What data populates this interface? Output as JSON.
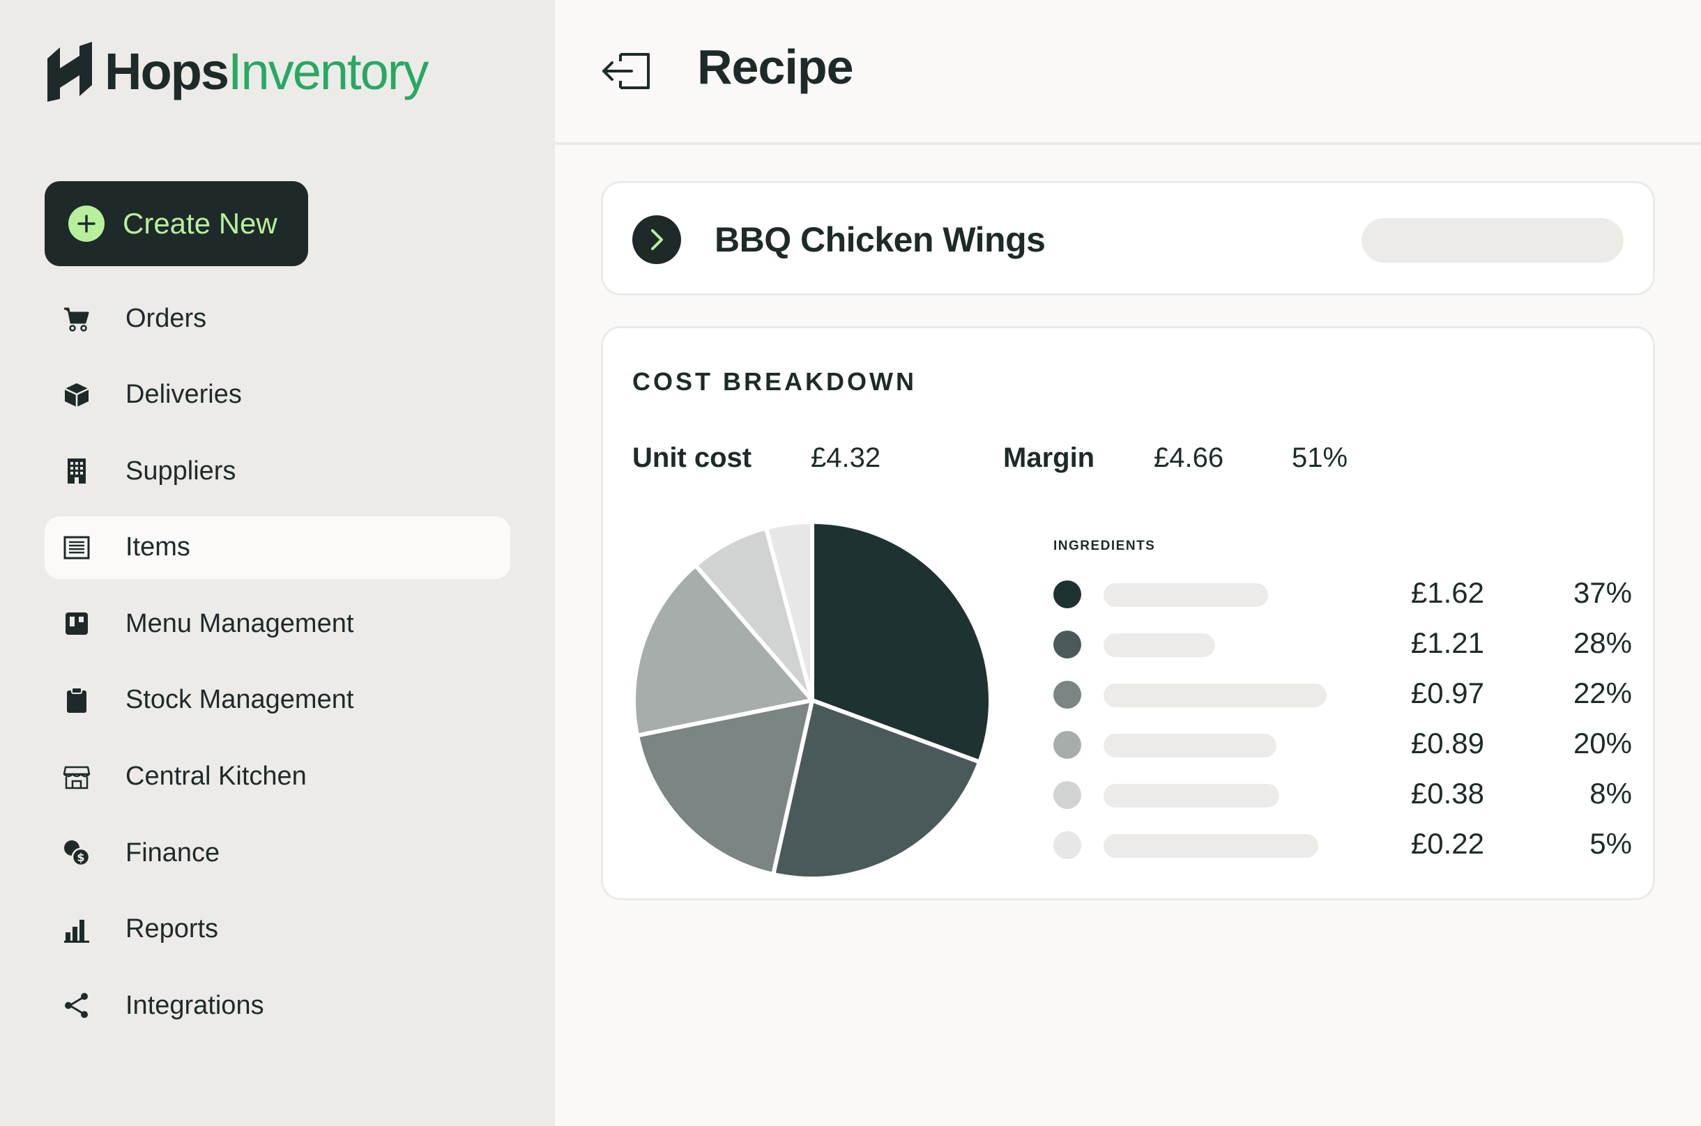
{
  "brand": {
    "word1": "Hops",
    "word2": "Inventory",
    "accent_color": "#27a865"
  },
  "sidebar": {
    "create_label": "Create New",
    "items": [
      {
        "label": "Orders",
        "icon": "cart-icon",
        "active": false
      },
      {
        "label": "Deliveries",
        "icon": "box-icon",
        "active": false
      },
      {
        "label": "Suppliers",
        "icon": "building-icon",
        "active": false
      },
      {
        "label": "Items",
        "icon": "list-icon",
        "active": true
      },
      {
        "label": "Menu Management",
        "icon": "menu-icon",
        "active": false
      },
      {
        "label": "Stock Management",
        "icon": "clipboard-icon",
        "active": false
      },
      {
        "label": "Central Kitchen",
        "icon": "store-icon",
        "active": false
      },
      {
        "label": "Finance",
        "icon": "coins-icon",
        "active": false
      },
      {
        "label": "Reports",
        "icon": "bar-chart-icon",
        "active": false
      },
      {
        "label": "Integrations",
        "icon": "share-icon",
        "active": false
      }
    ]
  },
  "header": {
    "title": "Recipe"
  },
  "recipe": {
    "name": "BBQ Chicken Wings"
  },
  "cost_breakdown": {
    "title": "COST BREAKDOWN",
    "unit_cost_label": "Unit cost",
    "unit_cost_value": "£4.32",
    "margin_label": "Margin",
    "margin_value": "£4.66",
    "margin_pct": "51%",
    "ingredients_title": "INGREDIENTS",
    "ingredients": [
      {
        "cost": "£1.62",
        "pct": "37%",
        "color": "#1e3232"
      },
      {
        "cost": "£1.21",
        "pct": "28%",
        "color": "#4a5a5a"
      },
      {
        "cost": "£0.97",
        "pct": "22%",
        "color": "#7a8584"
      },
      {
        "cost": "£0.89",
        "pct": "20%",
        "color": "#a6adab"
      },
      {
        "cost": "£0.38",
        "pct": "8%",
        "color": "#d0d3d2"
      },
      {
        "cost": "£0.22",
        "pct": "5%",
        "color": "#e6e7e6"
      }
    ]
  },
  "chart_data": {
    "type": "pie",
    "values": [
      1.62,
      1.21,
      0.97,
      0.89,
      0.38,
      0.22
    ],
    "percent_labels": [
      "37%",
      "28%",
      "22%",
      "20%",
      "8%",
      "5%"
    ],
    "colors": [
      "#1e3232",
      "#4a5a5a",
      "#7a8584",
      "#a6adab",
      "#d0d3d2",
      "#e6e7e6"
    ],
    "title": "",
    "legend": "right"
  }
}
